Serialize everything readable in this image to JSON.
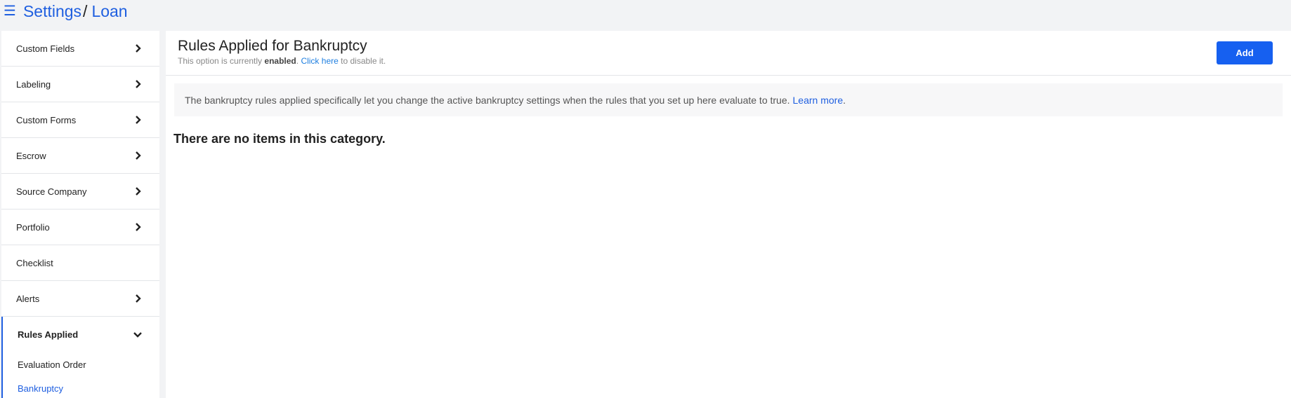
{
  "breadcrumb": {
    "root": "Settings",
    "separator": "/",
    "current": "Loan"
  },
  "sidebar": {
    "items": [
      {
        "label": "Custom Fields",
        "has_chevron": true
      },
      {
        "label": "Labeling",
        "has_chevron": true
      },
      {
        "label": "Custom Forms",
        "has_chevron": true
      },
      {
        "label": "Escrow",
        "has_chevron": true
      },
      {
        "label": "Source Company",
        "has_chevron": true
      },
      {
        "label": "Portfolio",
        "has_chevron": true
      },
      {
        "label": "Checklist",
        "has_chevron": false
      },
      {
        "label": "Alerts",
        "has_chevron": true
      }
    ],
    "expanded_group": {
      "label": "Rules Applied",
      "children": [
        {
          "label": "Evaluation Order",
          "active": false
        },
        {
          "label": "Bankruptcy",
          "active": true
        }
      ]
    }
  },
  "main": {
    "title": "Rules Applied for Bankruptcy",
    "status_prefix": "This option is currently",
    "status_value": "enabled",
    "status_link": "Click here",
    "status_suffix": "to disable it.",
    "add_label": "Add",
    "info_text": "The bankruptcy rules applied specifically let you change the active bankruptcy settings when the rules that you set up here evaluate to true.",
    "info_link": "Learn more",
    "empty_text": "There are no items in this category."
  },
  "colors": {
    "accent": "#1f5fe0",
    "button": "#1660f0",
    "background": "#f2f3f5"
  },
  "icons": {
    "menu": "hamburger-icon",
    "collapsed": "chevron-right-icon",
    "expanded": "chevron-down-icon"
  }
}
